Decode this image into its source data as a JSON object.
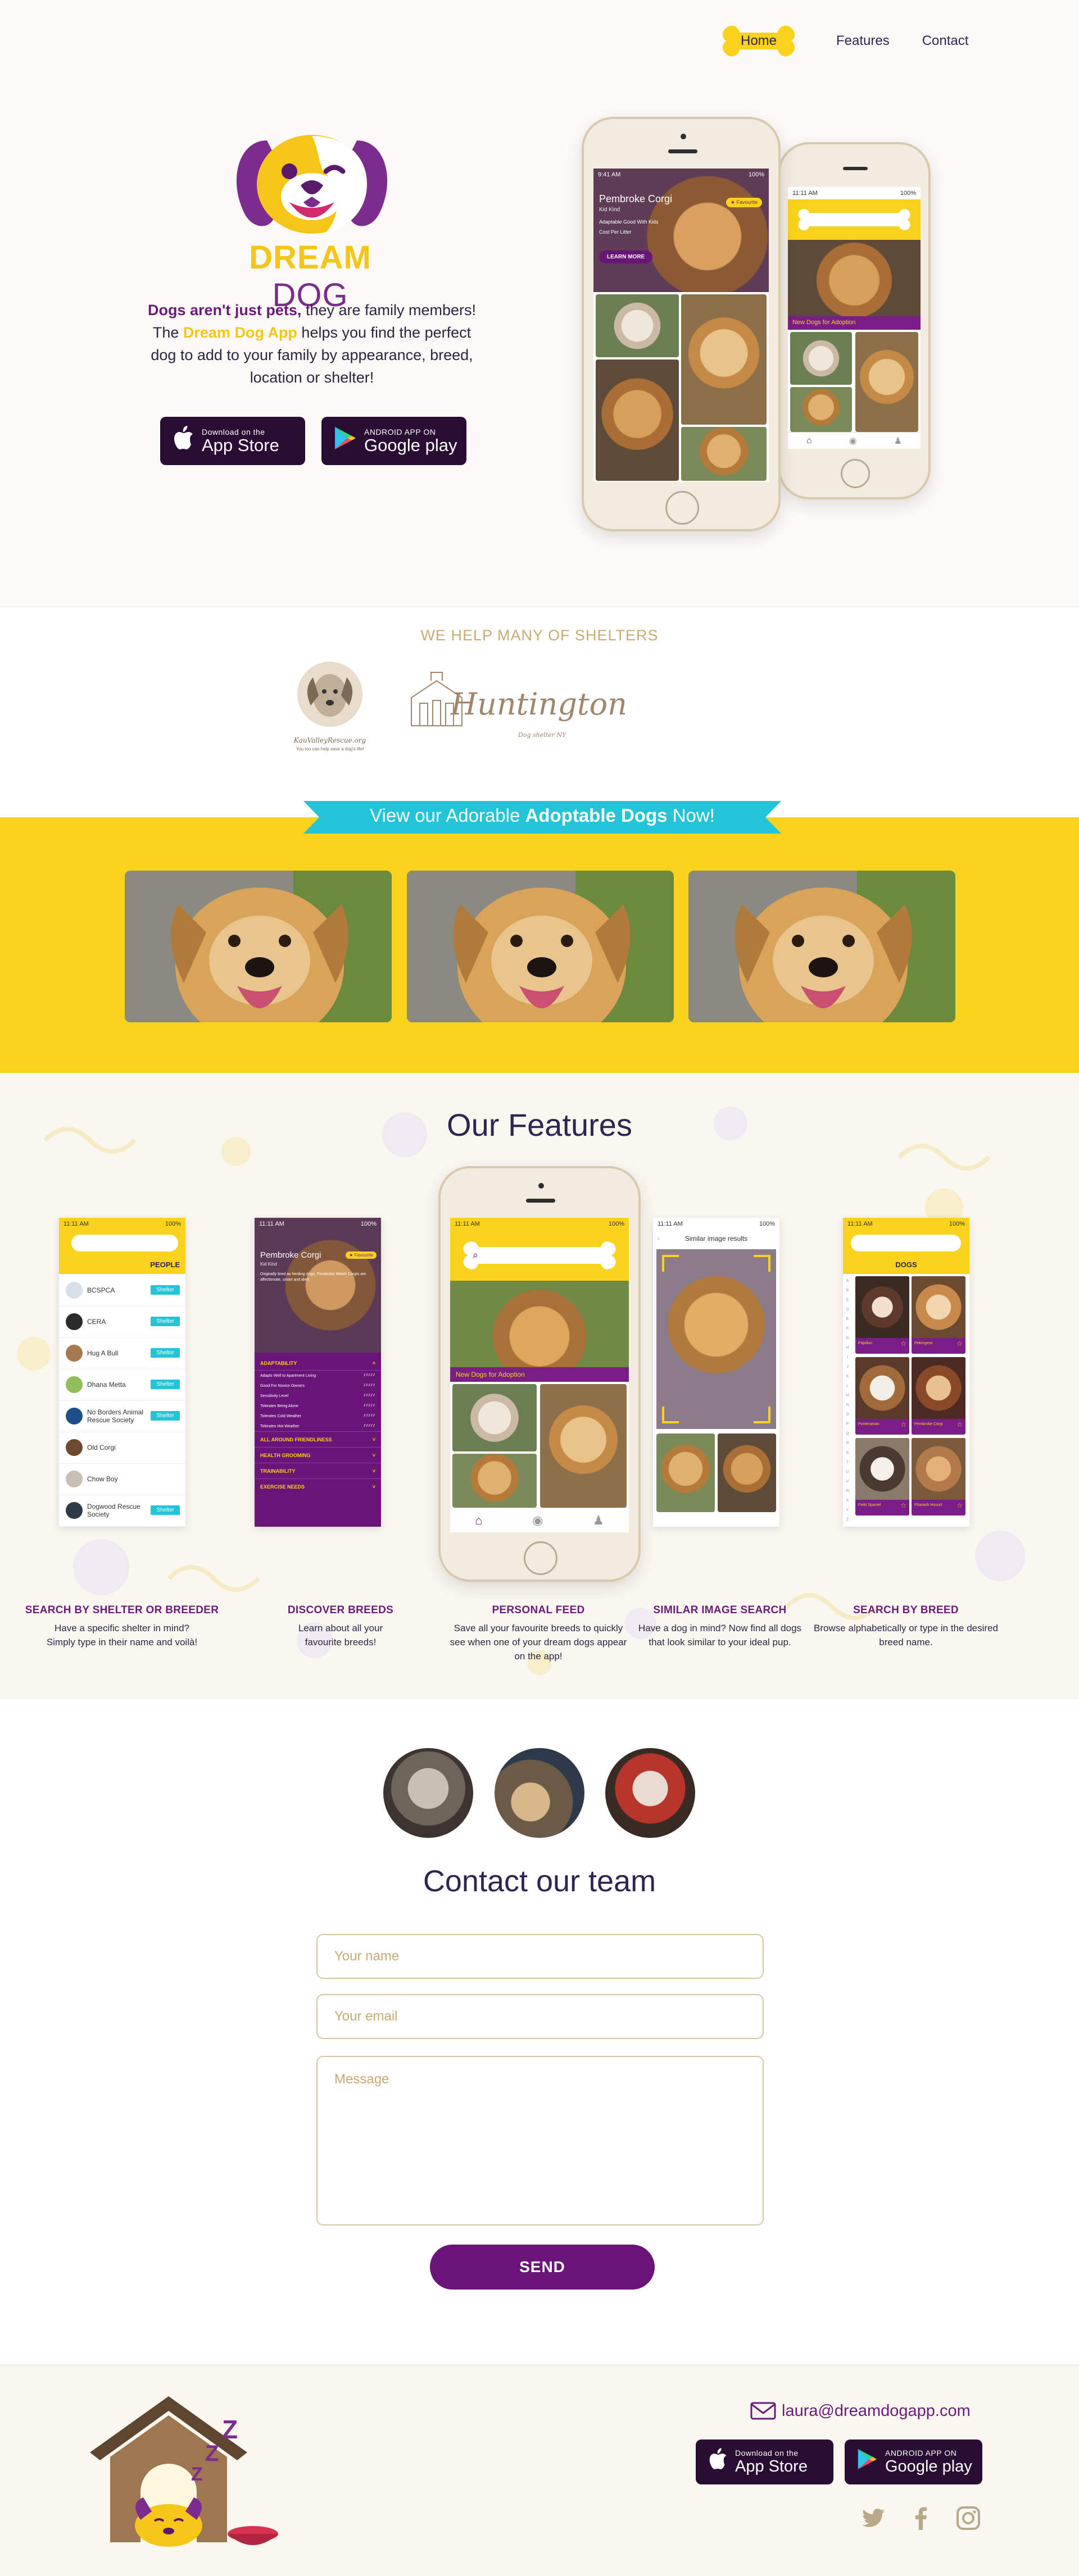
{
  "nav": {
    "home": "Home",
    "features": "Features",
    "contact": "Contact"
  },
  "brand": {
    "name_part1": "DREAM",
    "name_part2": "DOG"
  },
  "hero": {
    "copy_bold": "Dogs aren't just pets,",
    "copy_1": " they are family members!",
    "copy_2": "The ",
    "copy_app": "Dream Dog App",
    "copy_3": " helps you find the perfect dog to add to your family by appearance, breed, location or shelter!"
  },
  "stores": {
    "apple_small": "Download on the",
    "apple_large": "App Store",
    "google_small": "ANDROID APP ON",
    "google_large": "Google play"
  },
  "phone_main": {
    "time": "9:41 AM",
    "battery": "100%",
    "dog_name": "Pembroke Corgi",
    "dog_sub": "Kid Kind",
    "btn": "LEARN MORE",
    "fav": "Favourite",
    "line1": "Adaptable Good With Kids",
    "line2": "Cost Per Litter"
  },
  "phone_back": {
    "time": "11:11 AM",
    "battery": "100%",
    "tag": "New Dogs for Adoption"
  },
  "shelters": {
    "title": "WE HELP MANY OF SHELTERS",
    "logo1_name": "KauValleyRescue.org",
    "logo1_sub": "You too can help save a dog's life!",
    "logo2_name": "Huntington",
    "logo2_sub": "Dog shelter NY"
  },
  "adopt": {
    "ribbon_1": "View our Adorable ",
    "ribbon_bold": "Adoptable Dogs",
    "ribbon_2": " Now!"
  },
  "features": {
    "title": "Our Features",
    "s1": {
      "time": "11:11 AM",
      "battery": "100%",
      "header": "PEOPLE",
      "rows": [
        {
          "name": "BCSPCA",
          "badge": "Shelter"
        },
        {
          "name": "CERA",
          "badge": "Shelter"
        },
        {
          "name": "Hug A Bull",
          "badge": "Shelter"
        },
        {
          "name": "Dhana Metta",
          "badge": "Shelter"
        },
        {
          "name": "No Borders Animal Rescue Society",
          "badge": "Shelter"
        },
        {
          "name": "Old Corgi",
          "badge": ""
        },
        {
          "name": "Chow Boy",
          "badge": ""
        },
        {
          "name": "Dogwood Rescue Society",
          "badge": "Shelter"
        }
      ]
    },
    "s2": {
      "time": "11:11 AM",
      "battery": "100%",
      "dog_name": "Pembroke Corgi",
      "dog_sub": "Kid Kind",
      "fav": "Favourite",
      "desc": "Originally bred as herding dogs, Pembroke Welsh Corgis are affectionate, smart and alert.",
      "sections": [
        "ADAPTABILITY",
        "ALL AROUND FRIENDLINESS",
        "HEALTH GROOMING",
        "TRAINABILITY",
        "EXERCISE NEEDS"
      ],
      "traits": [
        "Adapts Well to Apartment Living",
        "Good For Novice Owners",
        "Sensitivity Level",
        "Tolerates Being Alone",
        "Tolerates Cold Weather",
        "Tolerates Hot Weather"
      ]
    },
    "s3": {
      "time": "11:11 AM",
      "battery": "100%",
      "tag": "New Dogs for Adoption"
    },
    "s4": {
      "time": "11:11 AM",
      "battery": "100%",
      "title": "Similar image results"
    },
    "s5": {
      "time": "11:11 AM",
      "battery": "100%",
      "header": "DOGS",
      "cards": [
        "Papillon",
        "Pekingese",
        "Pomeranian",
        "Pembroke Corgi",
        "Field Spaniel",
        "Pharaoh Hound"
      ],
      "letters": [
        "A",
        "B",
        "C",
        "D",
        "E",
        "F",
        "G",
        "H",
        "I",
        "J",
        "K",
        "L",
        "M",
        "N",
        "O",
        "P",
        "Q",
        "R",
        "S",
        "T",
        "U",
        "V",
        "W",
        "X",
        "Y",
        "Z"
      ]
    },
    "captions": [
      {
        "title": "SEARCH BY SHELTER OR BREEDER",
        "desc": "Have a specific shelter in mind? Simply type in their name and voilà!"
      },
      {
        "title": "DISCOVER BREEDS",
        "desc": "Learn about all your favourite breeds!"
      },
      {
        "title": "PERSONAL FEED",
        "desc": "Save all your favourite breeds to quickly see when one of your dream dogs appear on the app!"
      },
      {
        "title": "SIMILAR IMAGE SEARCH",
        "desc": "Have a dog in mind? Now find all dogs that look similar to your ideal pup."
      },
      {
        "title": "SEARCH BY BREED",
        "desc": "Browse alphabetically or type in the desired breed name."
      }
    ]
  },
  "contact": {
    "title": "Contact our team",
    "name_placeholder": "Your name",
    "email_placeholder": "Your email",
    "message_placeholder": "Message",
    "send": "SEND"
  },
  "footer": {
    "email": "laura@dreamdogapp.com",
    "zzz": "Z"
  },
  "colors": {
    "purple": "#6a1b7a",
    "yellow": "#f8d21b",
    "gold": "#c8ab72",
    "cyan": "#23c4d8",
    "navy": "#2f2550"
  },
  "icons": [
    "bone-icon",
    "apple-icon",
    "google-play-icon",
    "search-icon",
    "home-icon",
    "camera-icon",
    "person-icon",
    "star-icon",
    "heart-icon",
    "mail-icon",
    "twitter-icon",
    "facebook-icon",
    "instagram-icon",
    "chevron-down-icon",
    "back-arrow-icon"
  ]
}
